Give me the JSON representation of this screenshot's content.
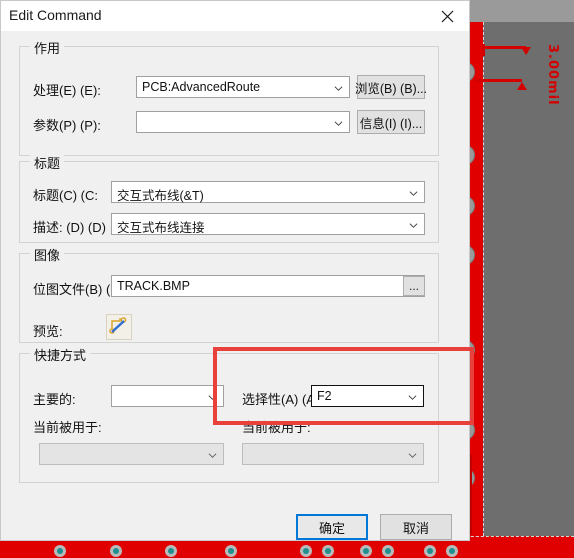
{
  "window": {
    "title": "Edit Command",
    "close_icon": "close-icon"
  },
  "groups": {
    "action": {
      "legend": "作用",
      "process_label": "处理(E) (E):",
      "process_value": "PCB:AdvancedRoute",
      "browse_button": "浏览(B) (B)...",
      "params_label": "参数(P) (P):",
      "params_value": "",
      "info_button": "信息(I) (I)..."
    },
    "caption": {
      "legend": "标题",
      "title_label": "标题(C) (C:",
      "title_value": "交互式布线(&T)",
      "desc_label": "描述: (D) (D)",
      "desc_value": "交互式布线连接"
    },
    "image": {
      "legend": "图像",
      "bitmap_label": "位图文件(B) (",
      "bitmap_value": "TRACK.BMP",
      "browse_dots": "...",
      "preview_label": "预览:",
      "preview_icon": "route-trace-icon"
    },
    "shortcut": {
      "legend": "快捷方式",
      "primary_label": "主要的:",
      "primary_value": "",
      "alternate_label": "选择性(A) (A",
      "alternate_value": "F2",
      "primary_used_label": "当前被用于:",
      "primary_used_value": "",
      "alternate_used_label": "当前被用于:",
      "alternate_used_value": ""
    }
  },
  "footer": {
    "ok_button": "确定",
    "cancel_button": "取消"
  },
  "background": {
    "dimension_label": "3.00mil",
    "copper_color": "#e00000",
    "annotation_color": "#d40000",
    "highlight_color": "#e8403a",
    "accent_color": "#0078d7"
  }
}
